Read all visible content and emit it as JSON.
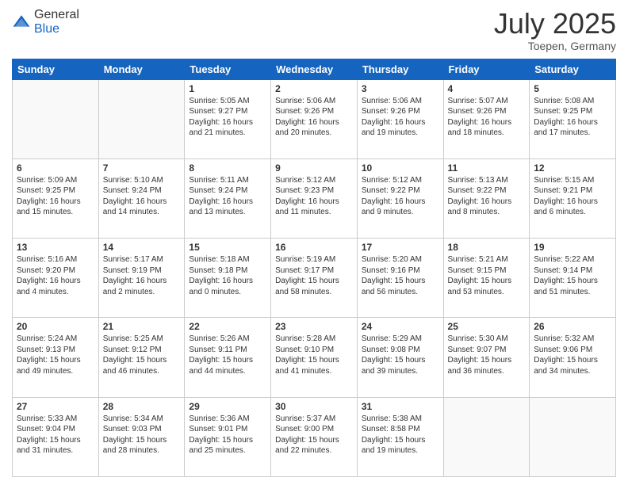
{
  "logo": {
    "general": "General",
    "blue": "Blue"
  },
  "header": {
    "month": "July 2025",
    "location": "Toepen, Germany"
  },
  "weekdays": [
    "Sunday",
    "Monday",
    "Tuesday",
    "Wednesday",
    "Thursday",
    "Friday",
    "Saturday"
  ],
  "weeks": [
    [
      {
        "day": "",
        "sunrise": "",
        "sunset": "",
        "daylight": ""
      },
      {
        "day": "",
        "sunrise": "",
        "sunset": "",
        "daylight": ""
      },
      {
        "day": "1",
        "sunrise": "Sunrise: 5:05 AM",
        "sunset": "Sunset: 9:27 PM",
        "daylight": "Daylight: 16 hours and 21 minutes."
      },
      {
        "day": "2",
        "sunrise": "Sunrise: 5:06 AM",
        "sunset": "Sunset: 9:26 PM",
        "daylight": "Daylight: 16 hours and 20 minutes."
      },
      {
        "day": "3",
        "sunrise": "Sunrise: 5:06 AM",
        "sunset": "Sunset: 9:26 PM",
        "daylight": "Daylight: 16 hours and 19 minutes."
      },
      {
        "day": "4",
        "sunrise": "Sunrise: 5:07 AM",
        "sunset": "Sunset: 9:26 PM",
        "daylight": "Daylight: 16 hours and 18 minutes."
      },
      {
        "day": "5",
        "sunrise": "Sunrise: 5:08 AM",
        "sunset": "Sunset: 9:25 PM",
        "daylight": "Daylight: 16 hours and 17 minutes."
      }
    ],
    [
      {
        "day": "6",
        "sunrise": "Sunrise: 5:09 AM",
        "sunset": "Sunset: 9:25 PM",
        "daylight": "Daylight: 16 hours and 15 minutes."
      },
      {
        "day": "7",
        "sunrise": "Sunrise: 5:10 AM",
        "sunset": "Sunset: 9:24 PM",
        "daylight": "Daylight: 16 hours and 14 minutes."
      },
      {
        "day": "8",
        "sunrise": "Sunrise: 5:11 AM",
        "sunset": "Sunset: 9:24 PM",
        "daylight": "Daylight: 16 hours and 13 minutes."
      },
      {
        "day": "9",
        "sunrise": "Sunrise: 5:12 AM",
        "sunset": "Sunset: 9:23 PM",
        "daylight": "Daylight: 16 hours and 11 minutes."
      },
      {
        "day": "10",
        "sunrise": "Sunrise: 5:12 AM",
        "sunset": "Sunset: 9:22 PM",
        "daylight": "Daylight: 16 hours and 9 minutes."
      },
      {
        "day": "11",
        "sunrise": "Sunrise: 5:13 AM",
        "sunset": "Sunset: 9:22 PM",
        "daylight": "Daylight: 16 hours and 8 minutes."
      },
      {
        "day": "12",
        "sunrise": "Sunrise: 5:15 AM",
        "sunset": "Sunset: 9:21 PM",
        "daylight": "Daylight: 16 hours and 6 minutes."
      }
    ],
    [
      {
        "day": "13",
        "sunrise": "Sunrise: 5:16 AM",
        "sunset": "Sunset: 9:20 PM",
        "daylight": "Daylight: 16 hours and 4 minutes."
      },
      {
        "day": "14",
        "sunrise": "Sunrise: 5:17 AM",
        "sunset": "Sunset: 9:19 PM",
        "daylight": "Daylight: 16 hours and 2 minutes."
      },
      {
        "day": "15",
        "sunrise": "Sunrise: 5:18 AM",
        "sunset": "Sunset: 9:18 PM",
        "daylight": "Daylight: 16 hours and 0 minutes."
      },
      {
        "day": "16",
        "sunrise": "Sunrise: 5:19 AM",
        "sunset": "Sunset: 9:17 PM",
        "daylight": "Daylight: 15 hours and 58 minutes."
      },
      {
        "day": "17",
        "sunrise": "Sunrise: 5:20 AM",
        "sunset": "Sunset: 9:16 PM",
        "daylight": "Daylight: 15 hours and 56 minutes."
      },
      {
        "day": "18",
        "sunrise": "Sunrise: 5:21 AM",
        "sunset": "Sunset: 9:15 PM",
        "daylight": "Daylight: 15 hours and 53 minutes."
      },
      {
        "day": "19",
        "sunrise": "Sunrise: 5:22 AM",
        "sunset": "Sunset: 9:14 PM",
        "daylight": "Daylight: 15 hours and 51 minutes."
      }
    ],
    [
      {
        "day": "20",
        "sunrise": "Sunrise: 5:24 AM",
        "sunset": "Sunset: 9:13 PM",
        "daylight": "Daylight: 15 hours and 49 minutes."
      },
      {
        "day": "21",
        "sunrise": "Sunrise: 5:25 AM",
        "sunset": "Sunset: 9:12 PM",
        "daylight": "Daylight: 15 hours and 46 minutes."
      },
      {
        "day": "22",
        "sunrise": "Sunrise: 5:26 AM",
        "sunset": "Sunset: 9:11 PM",
        "daylight": "Daylight: 15 hours and 44 minutes."
      },
      {
        "day": "23",
        "sunrise": "Sunrise: 5:28 AM",
        "sunset": "Sunset: 9:10 PM",
        "daylight": "Daylight: 15 hours and 41 minutes."
      },
      {
        "day": "24",
        "sunrise": "Sunrise: 5:29 AM",
        "sunset": "Sunset: 9:08 PM",
        "daylight": "Daylight: 15 hours and 39 minutes."
      },
      {
        "day": "25",
        "sunrise": "Sunrise: 5:30 AM",
        "sunset": "Sunset: 9:07 PM",
        "daylight": "Daylight: 15 hours and 36 minutes."
      },
      {
        "day": "26",
        "sunrise": "Sunrise: 5:32 AM",
        "sunset": "Sunset: 9:06 PM",
        "daylight": "Daylight: 15 hours and 34 minutes."
      }
    ],
    [
      {
        "day": "27",
        "sunrise": "Sunrise: 5:33 AM",
        "sunset": "Sunset: 9:04 PM",
        "daylight": "Daylight: 15 hours and 31 minutes."
      },
      {
        "day": "28",
        "sunrise": "Sunrise: 5:34 AM",
        "sunset": "Sunset: 9:03 PM",
        "daylight": "Daylight: 15 hours and 28 minutes."
      },
      {
        "day": "29",
        "sunrise": "Sunrise: 5:36 AM",
        "sunset": "Sunset: 9:01 PM",
        "daylight": "Daylight: 15 hours and 25 minutes."
      },
      {
        "day": "30",
        "sunrise": "Sunrise: 5:37 AM",
        "sunset": "Sunset: 9:00 PM",
        "daylight": "Daylight: 15 hours and 22 minutes."
      },
      {
        "day": "31",
        "sunrise": "Sunrise: 5:38 AM",
        "sunset": "Sunset: 8:58 PM",
        "daylight": "Daylight: 15 hours and 19 minutes."
      },
      {
        "day": "",
        "sunrise": "",
        "sunset": "",
        "daylight": ""
      },
      {
        "day": "",
        "sunrise": "",
        "sunset": "",
        "daylight": ""
      }
    ]
  ]
}
